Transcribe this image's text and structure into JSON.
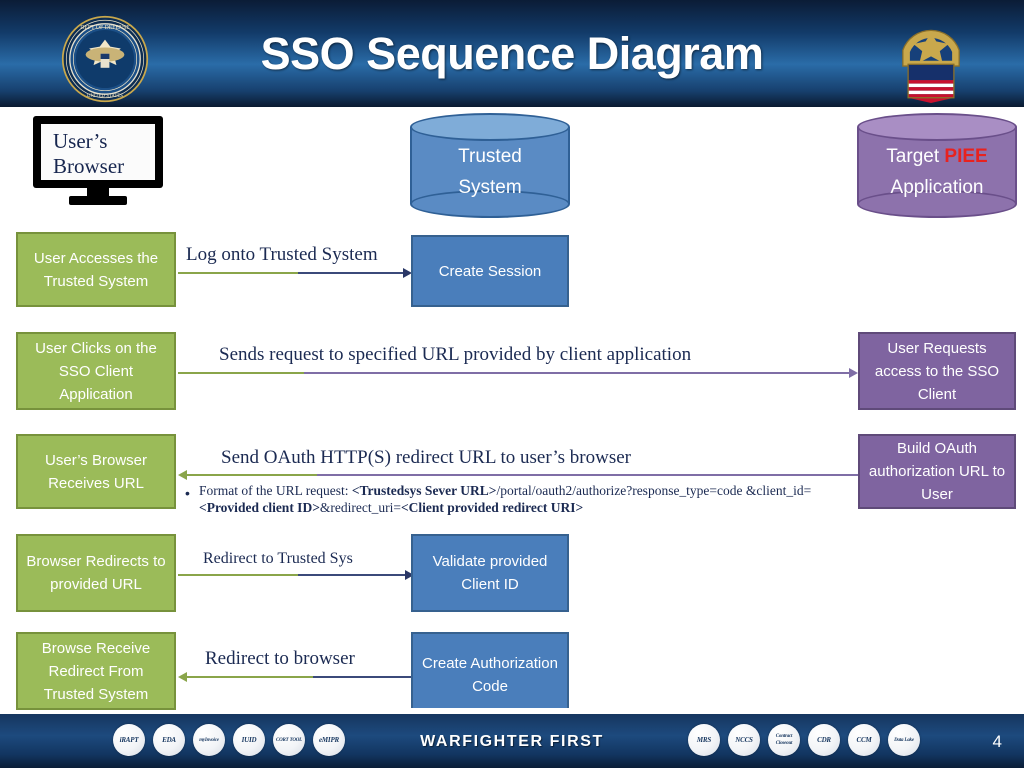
{
  "header": {
    "title": "SSO Sequence Diagram",
    "left_seal": "department-of-defense-seal",
    "right_seal": "defense-logistics-agency-seal"
  },
  "actors": {
    "browser": {
      "line1": "User’s",
      "line2": "Browser",
      "icon": "monitor-icon"
    },
    "trusted_system": {
      "line1": "Trusted",
      "line2": "System",
      "shape": "cylinder"
    },
    "target_app": {
      "prefix": "Target ",
      "highlight": "PIEE",
      "line2": "Application",
      "shape": "cylinder",
      "highlight_color": "#e8221f"
    }
  },
  "steps": {
    "browser_column": [
      {
        "label": "User Accesses the Trusted System"
      },
      {
        "label": "User Clicks on the SSO Client Application"
      },
      {
        "label": "User’s Browser Receives URL"
      },
      {
        "label": "Browser Redirects to provided URL"
      },
      {
        "label": "Browse Receive Redirect From Trusted System"
      }
    ],
    "trusted_column": [
      {
        "label": "Create Session"
      },
      {
        "label": "Validate provided Client ID"
      },
      {
        "label": "Create Authorization Code"
      }
    ],
    "target_column": [
      {
        "label": "User Requests access to the SSO Client"
      },
      {
        "label": "Build OAuth authorization URL to User"
      }
    ]
  },
  "arrows": [
    {
      "label": "Log onto Trusted System",
      "direction": "right"
    },
    {
      "label": "Sends request to specified URL provided by client application",
      "direction": "right"
    },
    {
      "label": "Send OAuth HTTP(S) redirect URL to user’s browser",
      "direction": "left"
    },
    {
      "label": "Redirect to Trusted Sys",
      "direction": "right"
    },
    {
      "label": "Redirect to browser",
      "direction": "left"
    }
  ],
  "url_note": {
    "bullet": "•",
    "part1": "Format of the URL request: ",
    "bold1": "<Trustedsys Sever URL>",
    "part2": "/portal/oauth2/authorize?response_type=code &client_id=",
    "bold2": "<Provided client ID>",
    "part3": "&redirect_uri=",
    "bold3": "<Client provided redirect URI>"
  },
  "footer": {
    "tagline": "WARFIGHTER FIRST",
    "page_number": "4",
    "badges_left": [
      "iRAPT",
      "EDA",
      "myInvoice",
      "IUID",
      "CORT TOOL",
      "eMIPR"
    ],
    "badges_right": [
      "MRS",
      "NCCS",
      "Contract Closeout",
      "CDR",
      "CCM",
      "Data Lake"
    ]
  },
  "colors": {
    "green": "#9bbb59",
    "blue": "#4a7ebb",
    "purple": "#7f64a0",
    "header_blue": "#16365f",
    "accent_red": "#e8221f"
  }
}
